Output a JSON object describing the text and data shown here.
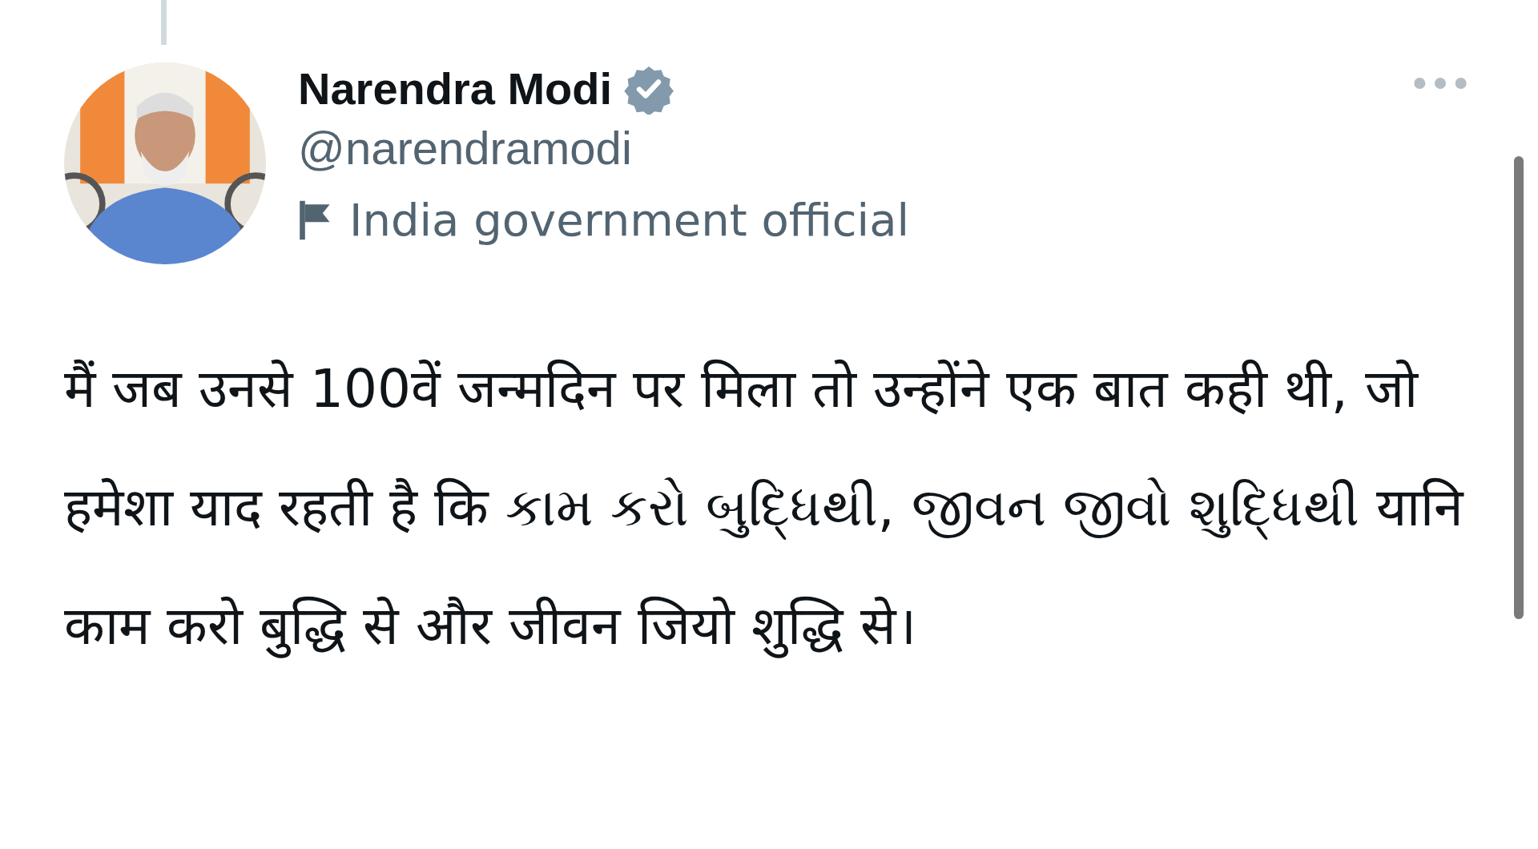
{
  "tweet": {
    "author": {
      "name": "Narendra Modi",
      "verified": true,
      "handle": "@narendramodi",
      "label": "India government official"
    },
    "text": "मैं जब उनसे 100वें जन्मदिन पर मिला तो उन्होंने एक बात कही थी, जो हमेशा याद रहती है कि કામ કરો બુદ્ધિથી, જીવન જીવો શુદ્ધિથી यानि काम करो बुद्धि से और जीवन जियो शुद्धि से।"
  }
}
